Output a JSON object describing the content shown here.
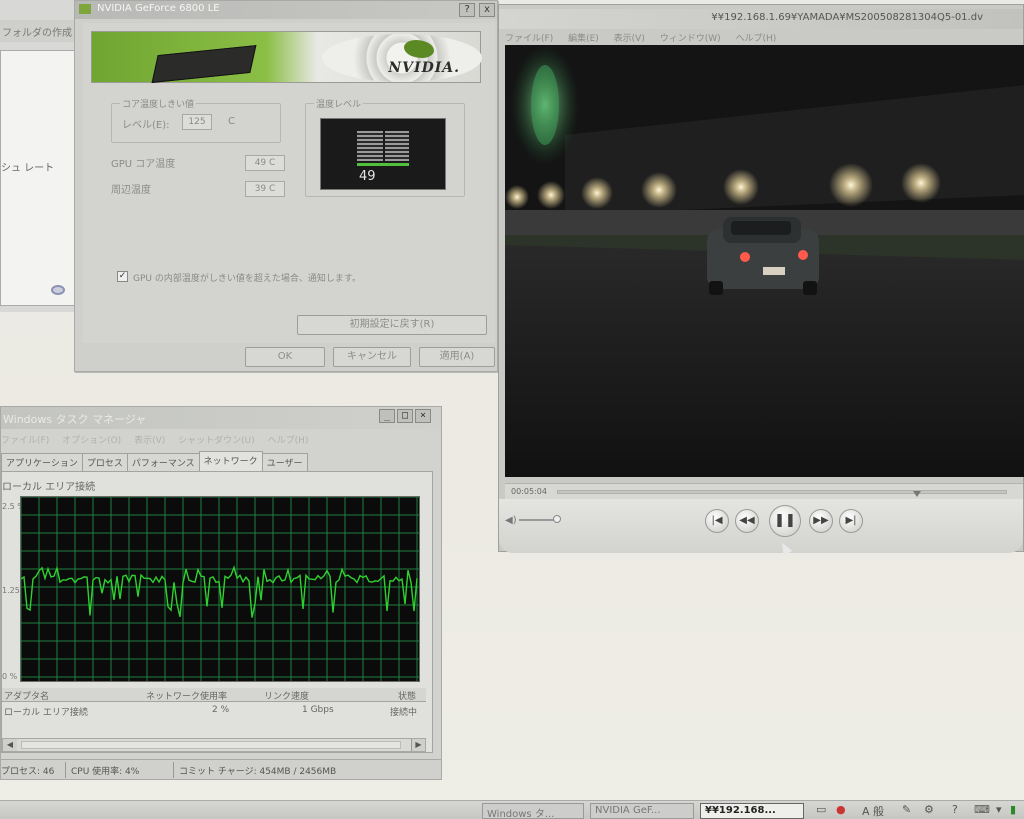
{
  "background_window": {
    "title": "フォルダの作成",
    "label": "シュ レート"
  },
  "nvidia_dialog": {
    "title": "NVIDIA GeForce 6800 LE",
    "help_button": "?",
    "close_button": "x",
    "banner_logo": "NVIDIA.",
    "core_threshold": {
      "group_label": "コア温度しきい値",
      "level_label": "レベル(E):",
      "level_value": "125",
      "unit": "C"
    },
    "gpu_core_temp": {
      "label": "GPU コア温度",
      "value": "49 C"
    },
    "ambient_temp": {
      "label": "周辺温度",
      "value": "39 C"
    },
    "temp_level": {
      "group_label": "温度レベル",
      "value": "49"
    },
    "warn_checkbox": {
      "checked": true,
      "label": "GPU の内部温度がしきい値を超えた場合、通知します。"
    },
    "restore_defaults_button": "初期設定に戻す(R)",
    "ok_button": "OK",
    "cancel_button": "キャンセル",
    "apply_button": "適用(A)",
    "colors": {
      "nvidia_green": "#76b900",
      "gauge_level": "#4fbf3c"
    }
  },
  "media_player": {
    "title": "¥¥192.168.1.69¥YAMADA¥MS200508281304Q5-01.dv",
    "menu": [
      "ファイル(F)",
      "編集(E)",
      "表示(V)",
      "ウィンドウ(W)",
      "ヘルプ(H)"
    ],
    "time": "00:05:04",
    "seek_progress": 0.79,
    "volume_icon": "volume-icon",
    "controls": {
      "prev": "|◀",
      "rewind": "◀◀",
      "pause": "❚❚",
      "fast_forward": "▶▶",
      "next": "▶|"
    }
  },
  "task_manager": {
    "title": "Windows タスク マネージャ",
    "menu": [
      "ファイル(F)",
      "オプション(O)",
      "表示(V)",
      "シャットダウン(U)",
      "ヘルプ(H)"
    ],
    "tabs": [
      "アプリケーション",
      "プロセス",
      "パフォーマンス",
      "ネットワーク",
      "ユーザー"
    ],
    "active_tab": "ネットワーク",
    "subtitle": "ローカル エリア接続",
    "graph_axis": [
      "2.5 %",
      "1.25 %",
      "0 %"
    ],
    "columns": [
      "アダプタ名",
      "ネットワーク使用率",
      "リンク速度",
      "状態"
    ],
    "rows": [
      {
        "name": "ローカル エリア接続",
        "usage": "2 %",
        "speed": "1 Gbps",
        "state": "接続中"
      }
    ],
    "status": {
      "processes": "プロセス: 46",
      "cpu": "CPU 使用率: 4%",
      "commit": "コミット チャージ: 454MB / 2456MB"
    },
    "window_buttons": [
      "_",
      "□",
      "×"
    ],
    "colors": {
      "graph_line": "#2fd12f",
      "graph_grid": "#1f7f3f"
    }
  },
  "taskbar": {
    "items": [
      {
        "label": "Windows タ...",
        "active": false
      },
      {
        "label": "NVIDIA GeF...",
        "active": false
      },
      {
        "label": "¥¥192.168...",
        "active": true
      }
    ],
    "tray_text": "A 般"
  }
}
